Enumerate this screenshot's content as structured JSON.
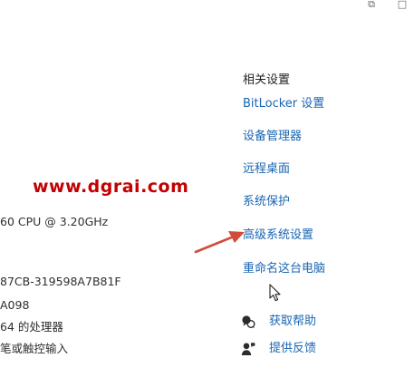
{
  "window": {
    "controls": {
      "restore_glyph": "⧉",
      "close_glyph": "□"
    }
  },
  "watermark": {
    "text": "www.dgrai.com",
    "color": "#c40000"
  },
  "system_info": {
    "lines": [
      "60 CPU @ 3.20GHz",
      "87CB-319598A7B81F",
      "A098",
      "64 的处理器",
      "笔或触控输入"
    ]
  },
  "related_settings": {
    "title": "相关设置",
    "links": [
      "BitLocker 设置",
      "设备管理器",
      "远程桌面",
      "系统保护",
      "高级系统设置",
      "重命名这台电脑"
    ]
  },
  "help": {
    "items": [
      {
        "label": "获取帮助",
        "icon": "help-chat-icon"
      },
      {
        "label": "提供反馈",
        "icon": "feedback-person-icon"
      }
    ]
  },
  "colors": {
    "link": "#1a66b3",
    "text": "#1f1f1f",
    "arrow": "#d24a3c"
  }
}
